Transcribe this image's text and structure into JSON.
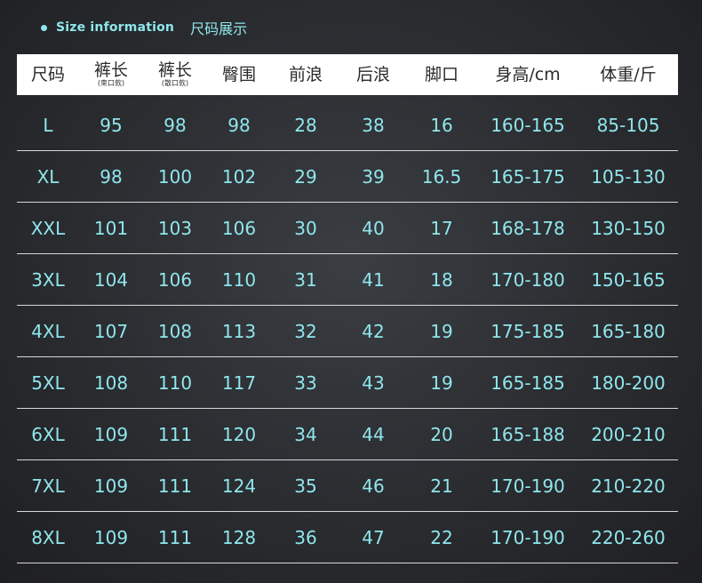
{
  "title": {
    "en": "Size information",
    "cn": "尺码展示"
  },
  "headers": [
    {
      "label": "尺码",
      "sub": ""
    },
    {
      "label": "裤长",
      "sub": "(束口款)"
    },
    {
      "label": "裤长",
      "sub": "(散口款)"
    },
    {
      "label": "臀围",
      "sub": ""
    },
    {
      "label": "前浪",
      "sub": ""
    },
    {
      "label": "后浪",
      "sub": ""
    },
    {
      "label": "脚口",
      "sub": ""
    },
    {
      "label": "身高/cm",
      "sub": ""
    },
    {
      "label": "体重/斤",
      "sub": ""
    }
  ],
  "rows": [
    [
      "L",
      "95",
      "98",
      "98",
      "28",
      "38",
      "16",
      "160-165",
      "85-105"
    ],
    [
      "XL",
      "98",
      "100",
      "102",
      "29",
      "39",
      "16.5",
      "165-175",
      "105-130"
    ],
    [
      "XXL",
      "101",
      "103",
      "106",
      "30",
      "40",
      "17",
      "168-178",
      "130-150"
    ],
    [
      "3XL",
      "104",
      "106",
      "110",
      "31",
      "41",
      "18",
      "170-180",
      "150-165"
    ],
    [
      "4XL",
      "107",
      "108",
      "113",
      "32",
      "42",
      "19",
      "175-185",
      "165-180"
    ],
    [
      "5XL",
      "108",
      "110",
      "117",
      "33",
      "43",
      "19",
      "165-185",
      "180-200"
    ],
    [
      "6XL",
      "109",
      "111",
      "120",
      "34",
      "44",
      "20",
      "165-188",
      "200-210"
    ],
    [
      "7XL",
      "109",
      "111",
      "124",
      "35",
      "46",
      "21",
      "170-190",
      "210-220"
    ],
    [
      "8XL",
      "109",
      "111",
      "128",
      "36",
      "47",
      "22",
      "170-190",
      "220-260"
    ]
  ],
  "colors": {
    "accent": "#8fe6ec",
    "background": "#2e3034",
    "header_bg": "#ffffff"
  }
}
